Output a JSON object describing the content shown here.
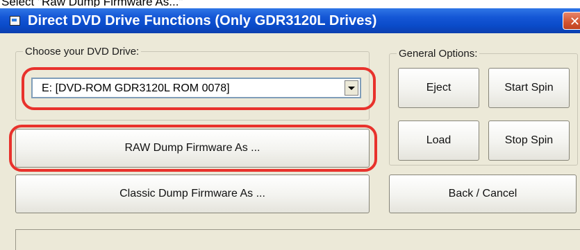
{
  "caption": "Select \"Raw Dump Firmware As...\"",
  "window": {
    "title": "Direct DVD Drive Functions (Only GDR3120L Drives)",
    "close_symbol": "✕"
  },
  "drive_group": {
    "label": "Choose your DVD Drive:",
    "selected_drive": "E: [DVD-ROM GDR3120L ROM 0078]"
  },
  "general_options": {
    "label": "General Options:",
    "eject_label": "Eject",
    "start_spin_label": "Start Spin",
    "load_label": "Load",
    "stop_spin_label": "Stop Spin"
  },
  "actions": {
    "raw_dump_label": "RAW Dump Firmware As ...",
    "classic_dump_label": "Classic Dump Firmware As ...",
    "back_cancel_label": "Back / Cancel"
  },
  "colors": {
    "titlebar": "#0a4bc9",
    "highlight": "#e8322c",
    "dialog_background": "#ece9d8"
  },
  "icons": {
    "title_icon": "window-app-icon",
    "close_icon": "close-icon",
    "dropdown_icon": "chevron-down-icon"
  }
}
